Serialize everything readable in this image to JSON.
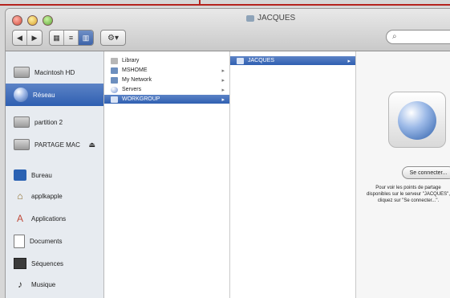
{
  "window": {
    "title": "JACQUES",
    "toolbar": {
      "back_label": "◀",
      "forward_label": "▶",
      "view_icon_label": "▦",
      "view_list_label": "≡",
      "view_columns_label": "▥",
      "action_label": "⚙▾"
    },
    "search": {
      "placeholder": ""
    }
  },
  "sidebar": {
    "items": [
      {
        "label": "Macintosh HD",
        "icon": "drive-icon"
      },
      {
        "label": "Réseau",
        "icon": "network-icon",
        "selected": true
      },
      {
        "label": "partition 2",
        "icon": "drive-icon"
      },
      {
        "label": "PARTAGE MAC",
        "icon": "drive-icon",
        "eject": "⏏"
      },
      {
        "label": "Bureau",
        "icon": "desktop-icon"
      },
      {
        "label": "applkapple",
        "icon": "home-icon"
      },
      {
        "label": "Applications",
        "icon": "apps-icon"
      },
      {
        "label": "Documents",
        "icon": "documents-icon"
      },
      {
        "label": "Séquences",
        "icon": "movies-icon"
      },
      {
        "label": "Musique",
        "icon": "music-icon"
      }
    ]
  },
  "columns": {
    "col1": [
      {
        "label": "Library",
        "icon": "folder-icon"
      },
      {
        "label": "MSHOME",
        "icon": "workgroup-icon",
        "has_children": true
      },
      {
        "label": "My Network",
        "icon": "workgroup-icon",
        "has_children": true
      },
      {
        "label": "Servers",
        "icon": "server-icon",
        "has_children": true
      },
      {
        "label": "WORKGROUP",
        "icon": "workgroup-icon",
        "has_children": true,
        "selected": true
      }
    ],
    "col2": [
      {
        "label": "JACQUES",
        "icon": "computer-icon",
        "has_children": true,
        "selected": true
      }
    ]
  },
  "preview": {
    "connect_button": "Se connecter...",
    "hint": "Pour voir les points de partage disponibles sur le serveur \"JACQUES\", cliquez sur \"Se connecter...\"."
  },
  "colors": {
    "selection": "#3b68b6",
    "sidebar_bg": "#e7ebf0",
    "title_redline": "#b5231e"
  }
}
